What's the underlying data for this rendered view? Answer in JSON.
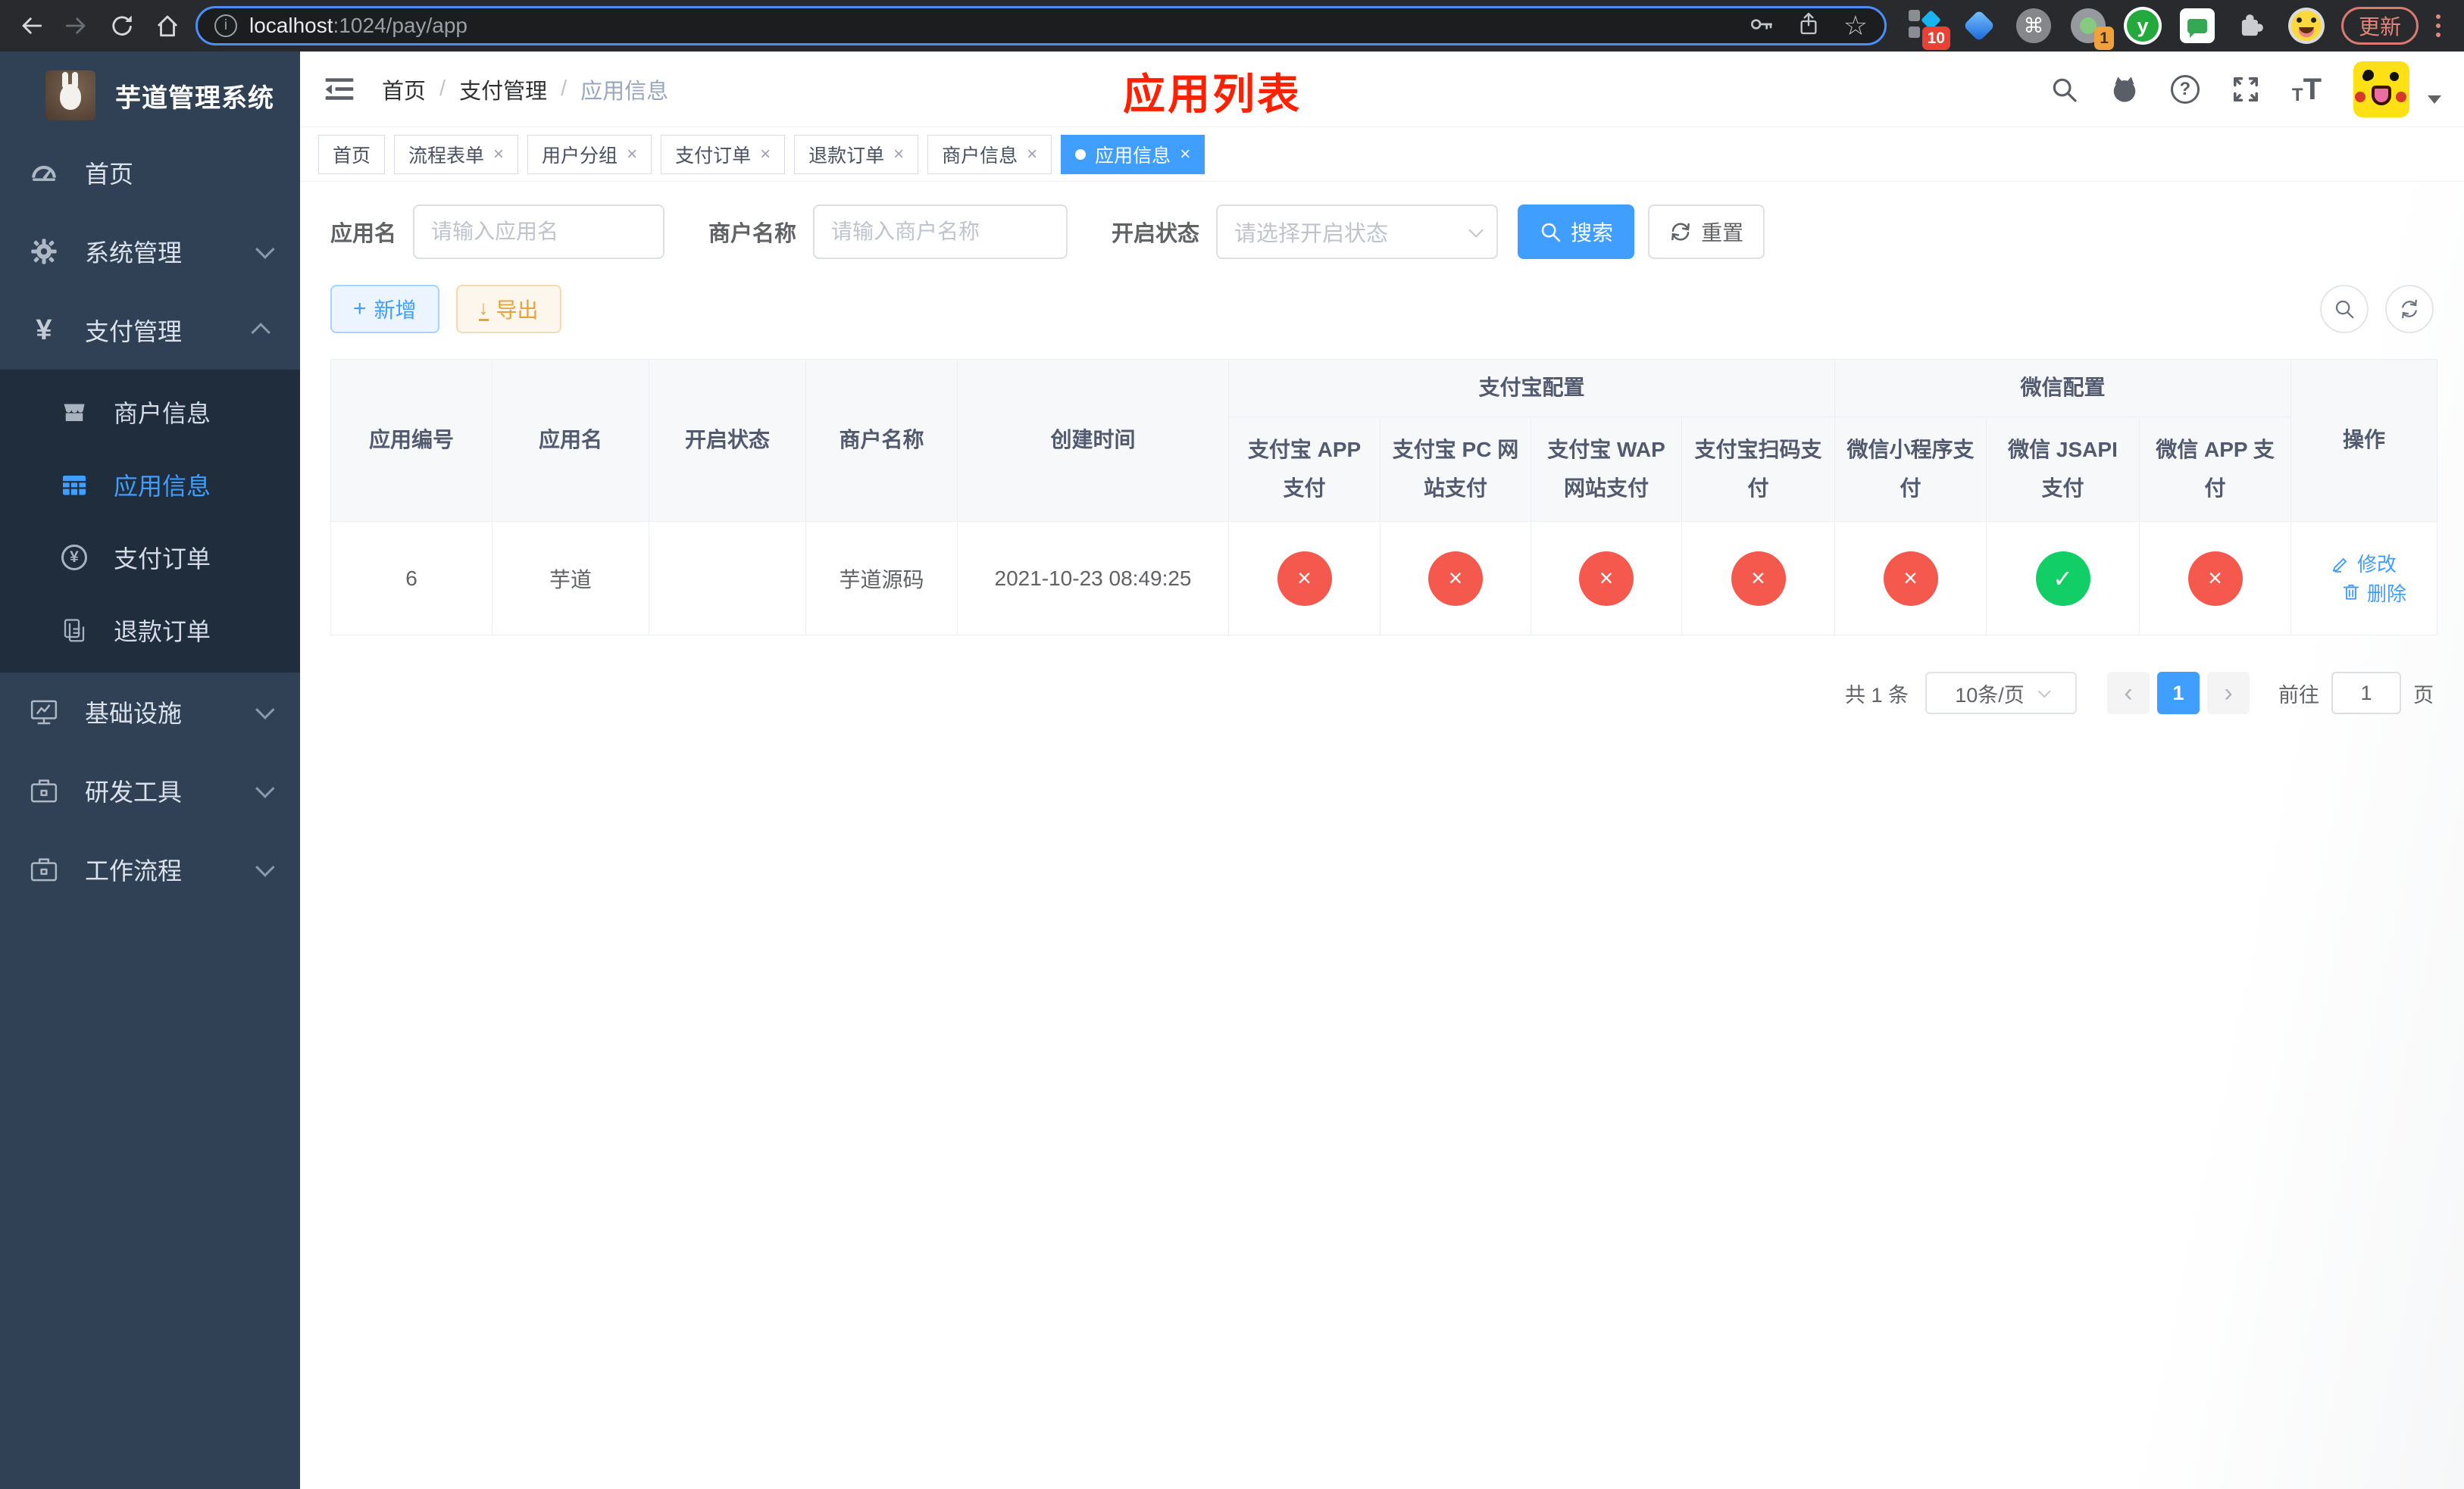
{
  "colors": {
    "accent": "#409eff",
    "danger": "#f5594e",
    "success": "#12ce66",
    "warning": "#e6a23c",
    "sidebar_bg": "#304156",
    "submenu_bg": "#1f2d3d",
    "annotation_red": "#ff2000"
  },
  "browser": {
    "url_host": "localhost",
    "url_path": ":1024/pay/app",
    "info_glyph": "i",
    "update_label": "更新",
    "ext_badge_blocks": "10",
    "ext_badge_profile": "1",
    "cmd_glyph": "⌘",
    "y_logyph": "y",
    "star_glyph": "☆"
  },
  "sidebar": {
    "title": "芋道管理系统",
    "yen_glyph": "¥",
    "items": [
      {
        "label": "首页"
      },
      {
        "label": "系统管理"
      },
      {
        "label": "支付管理"
      },
      {
        "label": "基础设施"
      },
      {
        "label": "研发工具"
      },
      {
        "label": "工作流程"
      }
    ],
    "submenu": [
      {
        "label": "商户信息"
      },
      {
        "label": "应用信息"
      },
      {
        "label": "支付订单"
      },
      {
        "label": "退款订单"
      }
    ]
  },
  "breadcrumb": {
    "items": [
      "首页",
      "支付管理",
      "应用信息"
    ],
    "separator": "/"
  },
  "overlay_title": "应用列表",
  "navbar_icons": {
    "help_glyph": "?",
    "small_t": "T",
    "big_t": "T"
  },
  "tabs": [
    {
      "label": "首页"
    },
    {
      "label": "流程表单"
    },
    {
      "label": "用户分组"
    },
    {
      "label": "支付订单"
    },
    {
      "label": "退款订单"
    },
    {
      "label": "商户信息"
    },
    {
      "label": "应用信息"
    }
  ],
  "tab_close_glyph": "×",
  "search": {
    "app_name_label": "应用名",
    "app_name_placeholder": "请输入应用名",
    "merchant_label": "商户名称",
    "merchant_placeholder": "请输入商户名称",
    "status_label": "开启状态",
    "status_placeholder": "请选择开启状态",
    "search_label": "搜索",
    "reset_label": "重置"
  },
  "actions": {
    "add_label": "新增",
    "add_glyph": "+",
    "export_label": "导出",
    "export_glyph": "↓"
  },
  "table": {
    "group_headers": {
      "alipay": "支付宝配置",
      "wechat": "微信配置"
    },
    "columns": {
      "app_id": "应用编号",
      "app_name": "应用名",
      "status": "开启状态",
      "merchant": "商户名称",
      "created": "创建时间",
      "alipay_app": "支付宝 APP 支付",
      "alipay_pc": "支付宝 PC 网站支付",
      "alipay_wap": "支付宝 WAP 网站支付",
      "alipay_qr": "支付宝扫码支付",
      "wx_mini": "微信小程序支付",
      "wx_jsapi": "微信 JSAPI 支付",
      "wx_app": "微信 APP 支付",
      "ops": "操作"
    },
    "row": {
      "app_id": "6",
      "app_name": "芋道",
      "enabled": true,
      "merchant": "芋道源码",
      "created": "2021-10-23 08:49:25",
      "channels": [
        false,
        false,
        false,
        false,
        false,
        true,
        false
      ],
      "edit_label": "修改",
      "delete_label": "删除"
    }
  },
  "pagination": {
    "total_label": "共 1 条",
    "page_size_label": "10条/页",
    "prev_glyph": "‹",
    "next_glyph": "›",
    "current_page": "1",
    "goto_label": "前往",
    "goto_value": "1",
    "page_suffix": "页"
  }
}
